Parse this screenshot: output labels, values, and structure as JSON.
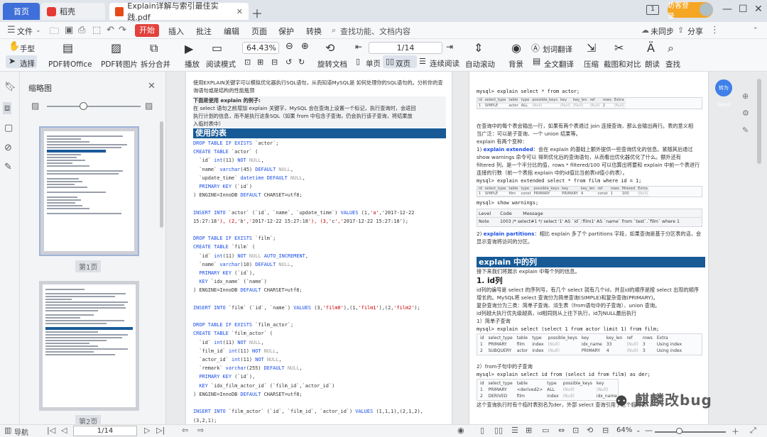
{
  "titlebar": {
    "tabs": [
      {
        "label": "首页"
      },
      {
        "label": "稻壳"
      },
      {
        "label": "Explain详解与索引最佳实践.pdf"
      }
    ],
    "login": "访客登录"
  },
  "menubar": {
    "file": "文件",
    "start": "开始",
    "items": [
      "插入",
      "批注",
      "编辑",
      "页面",
      "保护",
      "转换"
    ],
    "search": "查找功能、文档内容",
    "sync": "未同步",
    "share": "分享"
  },
  "toolbar": {
    "hand": "手型",
    "select": "选择",
    "pdf_to_office": "PDF转Office",
    "pdf_to_image": "PDF转图片",
    "split_merge": "拆分合并",
    "play": "播放",
    "read_mode": "阅读模式",
    "zoom": "64.43%",
    "rotate": "旋转文档",
    "page_counter": "1/14",
    "single": "单页",
    "double": "双页",
    "continuous": "连续阅读",
    "autoscroll": "自动滚动",
    "background": "背景",
    "word_translate": "划词翻译",
    "full_translate": "全文翻译",
    "compress": "压缩",
    "screenshot": "截图和对比",
    "read_aloud": "朗读",
    "find": "查找"
  },
  "thumbs": {
    "title": "缩略图",
    "page1": "第1页",
    "page2": "第2页"
  },
  "left_page": {
    "intro1": "使用EXPLAIN关键字可以模拟优化器执行SQL语句，从而知道MySQL是 如何处理你的SQL语句的。分析你的查",
    "intro2": "询语句或是结构的性能瓶颈",
    "example_title": "下面是使用 explain 的例子:",
    "p1": "在 select 语句之前增加 explain 关键字，MySQL 会在查询上设置一个标记，执行查询时，会返回",
    "p2": "执行计划的信息，而不是执行这条SQL（如果 from 中包含子查询，仍会执行该子查询，将结果放",
    "p3": "入临时表中）",
    "heading": "使用的表",
    "code": [
      "DROP TABLE IF EXISTS `actor`;",
      "CREATE TABLE `actor` (",
      "  `id` int(11) NOT NULL,",
      "  `name` varchar(45) DEFAULT NULL,",
      "  `update_time` datetime DEFAULT NULL,",
      "  PRIMARY KEY (`id`)",
      ") ENGINE=InnoDB DEFAULT CHARSET=utf8;",
      "",
      "INSERT INTO `actor` (`id`, `name`, `update_time`) VALUES (1,'a','2017-12-22",
      "15:27:18'), (2,'b','2017-12-22 15:27:18'), (3,'c','2017-12-22 15:27:18');",
      "",
      "DROP TABLE IF EXISTS `film`;",
      "CREATE TABLE `film` (",
      "  `id` int(11) NOT NULL AUTO_INCREMENT,",
      "  `name` varchar(10) DEFAULT NULL,",
      "  PRIMARY KEY (`id`),",
      "  KEY `idx_name` (`name`)",
      ") ENGINE=InnoDB DEFAULT CHARSET=utf8;",
      "",
      "INSERT INTO `film` (`id`, `name`) VALUES (3,'film0'),(1,'film1'),(2,'film2');",
      "",
      "DROP TABLE IF EXISTS `film_actor`;",
      "CREATE TABLE `film_actor` (",
      "  `id` int(11) NOT NULL,",
      "  `film_id` int(11) NOT NULL,",
      "  `actor_id` int(11) NOT NULL,",
      "  `remark` varchar(255) DEFAULT NULL,",
      "  PRIMARY KEY (`id`),",
      "  KEY `idx_film_actor_id` (`film_id`,`actor_id`)",
      ") ENGINE=InnoDB DEFAULT CHARSET=utf8;",
      "",
      "INSERT INTO `film_actor` (`id`, `film_id`, `actor_id`) VALUES (1,1,1),(2,1,2),",
      "(3,2,1);"
    ]
  },
  "right_page": {
    "q1": "mysql> explain select * from actor;",
    "p1": "在查询中的每个表会输出一行，如果有两个表通过 join 连接查询，那么会输出两行。表的意义相",
    "p2": "当广泛：可以是子查询、一个 union 结果等。",
    "p3": "explain 有两个变种：",
    "p4_label": "explain extended",
    "p4": "：会在 explain  的基础上额外提供一些查询优化的信息。紧随其后通过",
    "p5": "show warnings 命令可以 得到优化后的查询语句，从而看出优化器优化了什么。额外还有",
    "p6": "filtered 列，是一个半分比的值，rows * filtered/100 可以估算出将要和 explain 中前一个表进行",
    "p7": "连接的行数（前一个表指 explain 中的id值比当前表id值小的表）。",
    "q2": "mysql> explain extended select * from film where id = 1;",
    "q3": "mysql> show warnings;",
    "warn_head": [
      "Level",
      "Code",
      "Message"
    ],
    "warn_row": [
      "Note",
      "1003 /* select#1 */ select '1' AS `id`,'film1' AS `name` from `test`.`film` where 1"
    ],
    "p8_label": "explain partitions",
    "p8": "：相比 explain 多了个 partitions 字段，如果查询是基于分区表的话，会",
    "p9": "显示查询将访问的分区。",
    "heading": "explain 中的列",
    "p10": "接下来我们将展示 explain 中每个列的信息。",
    "h_id": "1. id列",
    "p11": "id列的编号是 select 的序列号，有几个 select 就有几个id，并且id的顺序是按 select 出现的顺序",
    "p12": "增长的。MySQL将 select 查询分为简单查询(SIMPLE)和复杂查询(PRIMARY)。",
    "p13": "复杂查询分为三类：简单子查询、派生表（from语句中的子查询）、union 查询。",
    "p14": "id列越大执行优先级越高，id相同则从上往下执行，id为NULL最后执行",
    "sub1": "1）简单子查询",
    "q4": "mysql> explain select (select 1 from actor limit 1) from film;",
    "sub2": "2）from子句中的子查询",
    "q5": "mysql> explain select id from (select id from film) as der;",
    "p15": "这个查询执行时有个临时表别名为der，外部 select 查询引用了这个临时表",
    "translate_badge": "转为Word"
  },
  "mini_tables": {
    "t1_head": [
      "id",
      "select_type",
      "table",
      "type",
      "possible_keys",
      "key",
      "key_len",
      "ref",
      "rows",
      "Extra"
    ],
    "t1_row": [
      "1",
      "SIMPLE",
      "actor",
      "ALL",
      "(Null)",
      "(Null)",
      "(Null)",
      "(Null)",
      "2",
      "(Null)"
    ],
    "t2_head": [
      "id",
      "select_type",
      "table",
      "type",
      "possible_keys",
      "key",
      "key_len",
      "ref",
      "rows",
      "filtered",
      "Extra"
    ],
    "t2_row": [
      "1",
      "SIMPLE",
      "film",
      "const",
      "PRIMARY",
      "PRIMARY",
      "4",
      "const",
      "1",
      "100",
      "(Null)"
    ],
    "t3_head": [
      "id",
      "select_type",
      "table",
      "type",
      "possible_keys",
      "key",
      "key_len",
      "ref",
      "rows",
      "Extra"
    ],
    "t3_rows": [
      [
        "1",
        "PRIMARY",
        "film",
        "index",
        "(Null)",
        "idx_name",
        "33",
        "(Null)",
        "3",
        "Using index"
      ],
      [
        "2",
        "SUBQUERY",
        "actor",
        "index",
        "(Null)",
        "PRIMARY",
        "4",
        "(Null)",
        "3",
        "Using index"
      ]
    ],
    "t4_head": [
      "id",
      "select_type",
      "table",
      "type",
      "possible_keys",
      "key"
    ],
    "t4_rows": [
      [
        "1",
        "PRIMARY",
        "<derived2>",
        "ALL",
        "(Null)",
        "(Null)"
      ],
      [
        "2",
        "DERIVED",
        "film",
        "index",
        "(Null)",
        "idx_name"
      ]
    ]
  },
  "statusbar": {
    "nav": "导航",
    "page": "1/14",
    "zoom": "64%"
  },
  "watermark": "麒麟改bug"
}
